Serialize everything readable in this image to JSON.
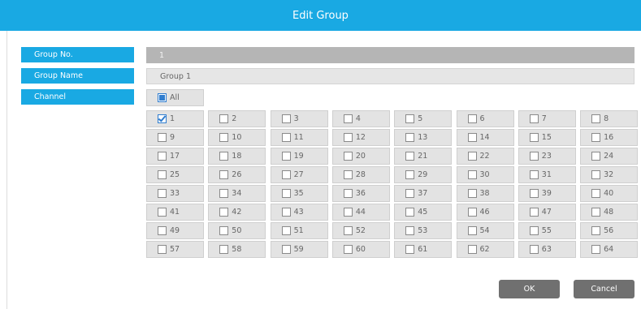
{
  "dialog": {
    "title": "Edit Group"
  },
  "fields": {
    "group_no_label": "Group No.",
    "group_no_value": "1",
    "group_name_label": "Group Name",
    "group_name_value": "Group 1",
    "channel_label": "Channel"
  },
  "channels": {
    "all_label": "All",
    "all_state": "partial",
    "items": [
      {
        "label": "1",
        "checked": true
      },
      {
        "label": "2",
        "checked": false
      },
      {
        "label": "3",
        "checked": false
      },
      {
        "label": "4",
        "checked": false
      },
      {
        "label": "5",
        "checked": false
      },
      {
        "label": "6",
        "checked": false
      },
      {
        "label": "7",
        "checked": false
      },
      {
        "label": "8",
        "checked": false
      },
      {
        "label": "9",
        "checked": false
      },
      {
        "label": "10",
        "checked": false
      },
      {
        "label": "11",
        "checked": false
      },
      {
        "label": "12",
        "checked": false
      },
      {
        "label": "13",
        "checked": false
      },
      {
        "label": "14",
        "checked": false
      },
      {
        "label": "15",
        "checked": false
      },
      {
        "label": "16",
        "checked": false
      },
      {
        "label": "17",
        "checked": false
      },
      {
        "label": "18",
        "checked": false
      },
      {
        "label": "19",
        "checked": false
      },
      {
        "label": "20",
        "checked": false
      },
      {
        "label": "21",
        "checked": false
      },
      {
        "label": "22",
        "checked": false
      },
      {
        "label": "23",
        "checked": false
      },
      {
        "label": "24",
        "checked": false
      },
      {
        "label": "25",
        "checked": false
      },
      {
        "label": "26",
        "checked": false
      },
      {
        "label": "27",
        "checked": false
      },
      {
        "label": "28",
        "checked": false
      },
      {
        "label": "29",
        "checked": false
      },
      {
        "label": "30",
        "checked": false
      },
      {
        "label": "31",
        "checked": false
      },
      {
        "label": "32",
        "checked": false
      },
      {
        "label": "33",
        "checked": false
      },
      {
        "label": "34",
        "checked": false
      },
      {
        "label": "35",
        "checked": false
      },
      {
        "label": "36",
        "checked": false
      },
      {
        "label": "37",
        "checked": false
      },
      {
        "label": "38",
        "checked": false
      },
      {
        "label": "39",
        "checked": false
      },
      {
        "label": "40",
        "checked": false
      },
      {
        "label": "41",
        "checked": false
      },
      {
        "label": "42",
        "checked": false
      },
      {
        "label": "43",
        "checked": false
      },
      {
        "label": "44",
        "checked": false
      },
      {
        "label": "45",
        "checked": false
      },
      {
        "label": "46",
        "checked": false
      },
      {
        "label": "47",
        "checked": false
      },
      {
        "label": "48",
        "checked": false
      },
      {
        "label": "49",
        "checked": false
      },
      {
        "label": "50",
        "checked": false
      },
      {
        "label": "51",
        "checked": false
      },
      {
        "label": "52",
        "checked": false
      },
      {
        "label": "53",
        "checked": false
      },
      {
        "label": "54",
        "checked": false
      },
      {
        "label": "55",
        "checked": false
      },
      {
        "label": "56",
        "checked": false
      },
      {
        "label": "57",
        "checked": false
      },
      {
        "label": "58",
        "checked": false
      },
      {
        "label": "59",
        "checked": false
      },
      {
        "label": "60",
        "checked": false
      },
      {
        "label": "61",
        "checked": false
      },
      {
        "label": "62",
        "checked": false
      },
      {
        "label": "63",
        "checked": false
      },
      {
        "label": "64",
        "checked": false
      }
    ]
  },
  "buttons": {
    "ok": "OK",
    "cancel": "Cancel"
  },
  "colors": {
    "accent": "#19a9e3",
    "button": "#707070",
    "checkbox": "#2f7dcf"
  }
}
